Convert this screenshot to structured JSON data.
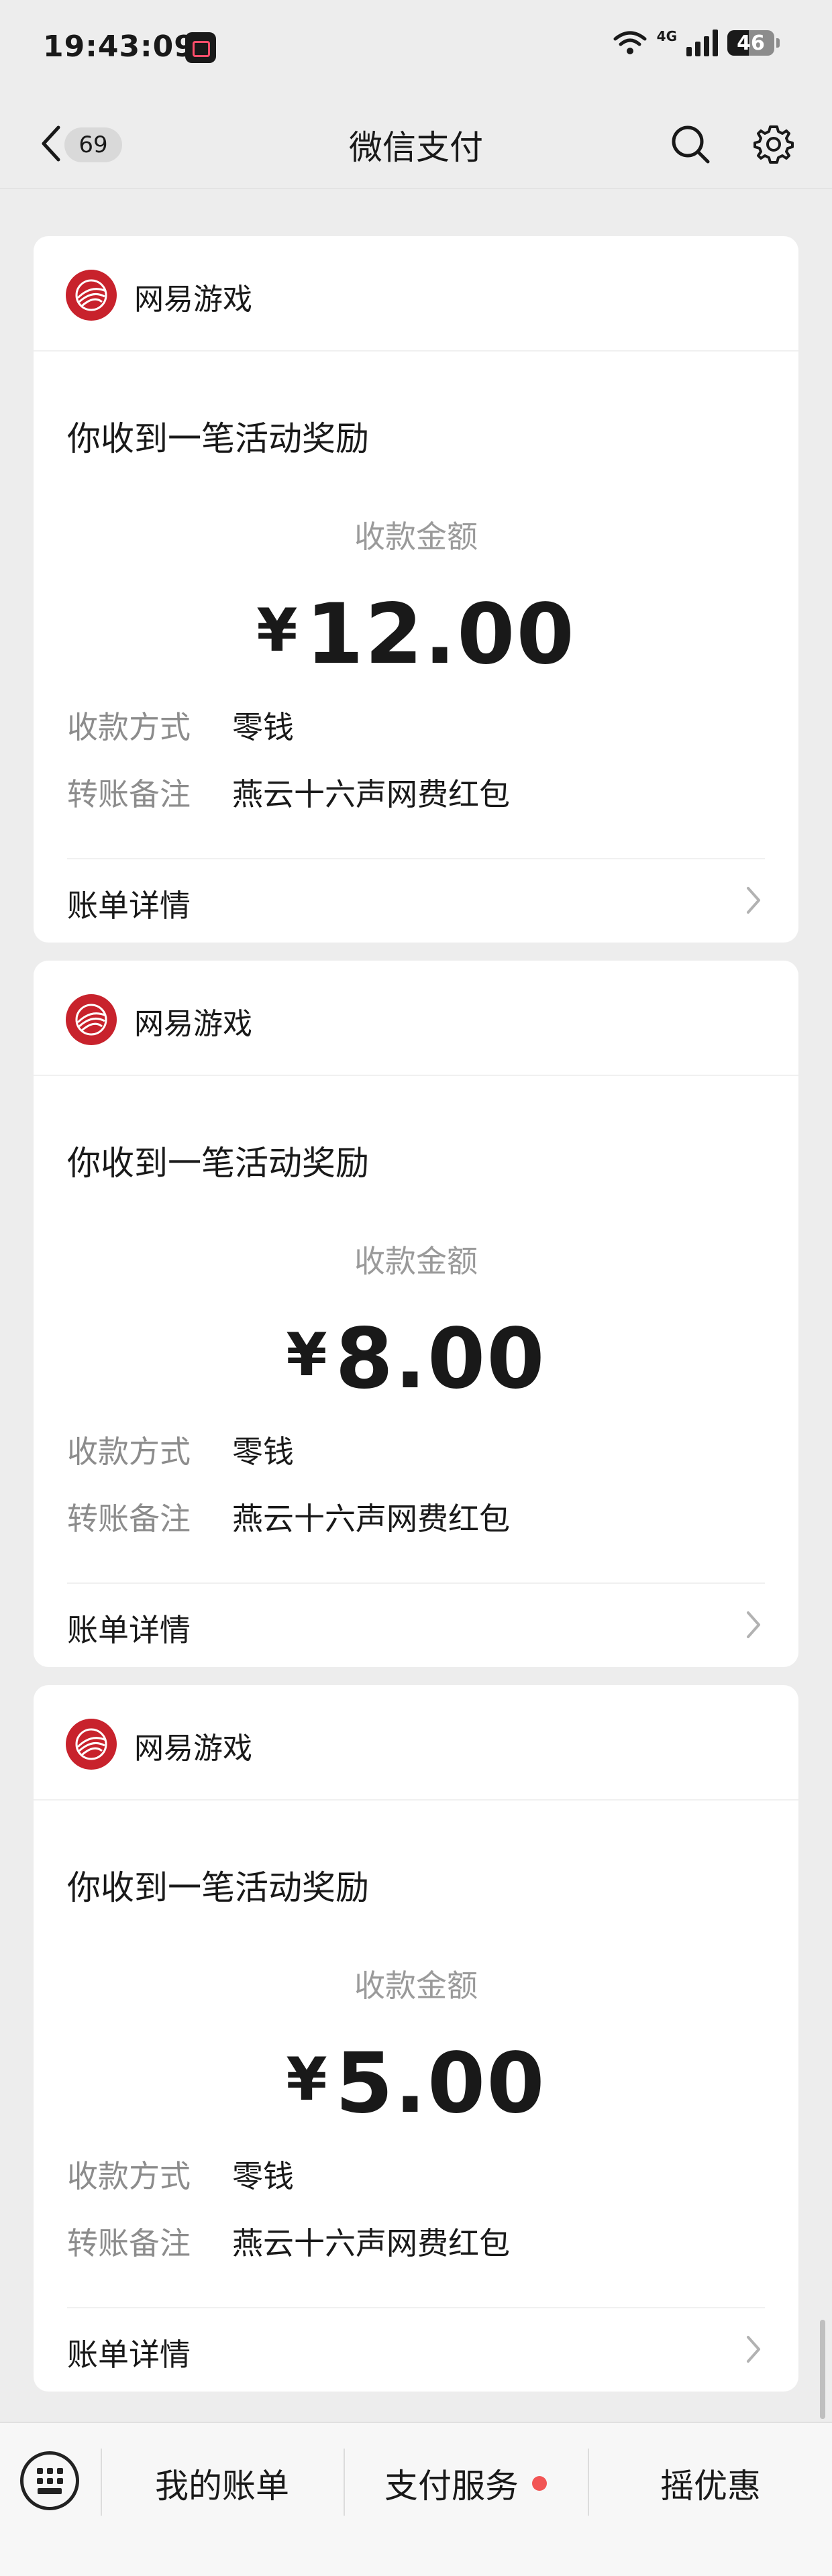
{
  "status_bar": {
    "time": "19:43:09",
    "network": "4G",
    "battery": "46",
    "battery_level": 0.46
  },
  "nav": {
    "back_icon": "chevron-left-icon",
    "unread_count": "69",
    "title": "微信支付",
    "search_icon": "search-icon",
    "settings_icon": "gear-icon"
  },
  "cards": [
    {
      "brand": "网易游戏",
      "headline": "你收到一笔活动奖励",
      "amount_label": "收款金额",
      "currency": "¥",
      "amount": "12.00",
      "method_label": "收款方式",
      "method_value": "零钱",
      "note_label": "转账备注",
      "note_value": "燕云十六声网费红包",
      "detail_label": "账单详情"
    },
    {
      "brand": "网易游戏",
      "headline": "你收到一笔活动奖励",
      "amount_label": "收款金额",
      "currency": "¥",
      "amount": "8.00",
      "method_label": "收款方式",
      "method_value": "零钱",
      "note_label": "转账备注",
      "note_value": "燕云十六声网费红包",
      "detail_label": "账单详情"
    },
    {
      "brand": "网易游戏",
      "headline": "你收到一笔活动奖励",
      "amount_label": "收款金额",
      "currency": "¥",
      "amount": "5.00",
      "method_label": "收款方式",
      "method_value": "零钱",
      "note_label": "转账备注",
      "note_value": "燕云十六声网费红包",
      "detail_label": "账单详情"
    }
  ],
  "bottom_bar": {
    "keyboard_icon": "keyboard-icon",
    "tabs": [
      "我的账单",
      "支付服务",
      "摇优惠"
    ],
    "notification_dot_color": "#f25555"
  },
  "colors": {
    "background": "#ededed",
    "card": "#ffffff",
    "brand_red": "#c8222c"
  }
}
